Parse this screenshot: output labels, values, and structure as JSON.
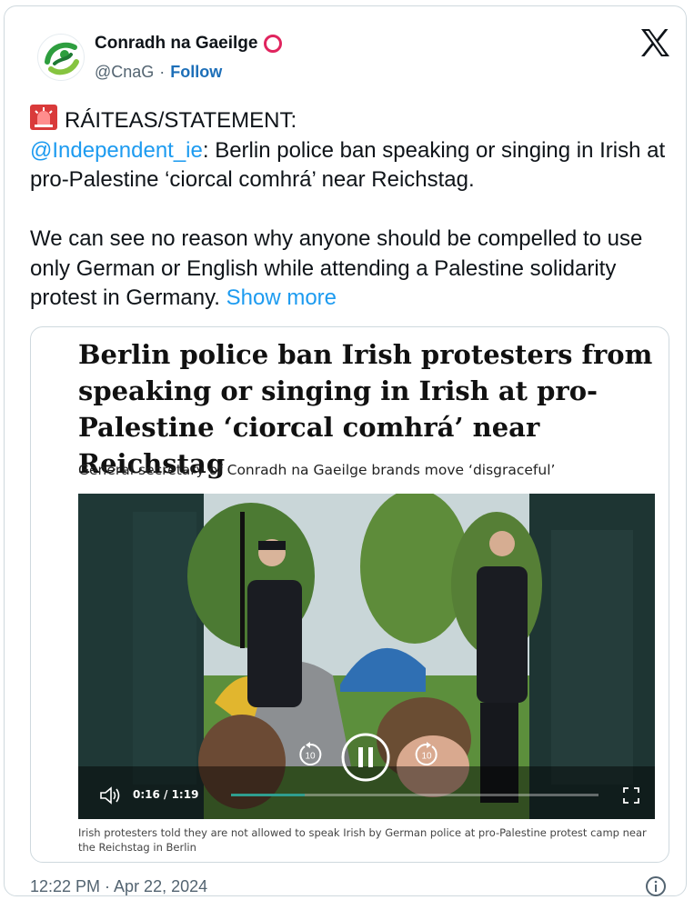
{
  "author": {
    "name": "Conradh na Gaeilge",
    "handle": "@CnaG",
    "separator": "·",
    "follow_label": "Follow",
    "avatar_icon": "conradh-logo-icon",
    "badge_icon": "red-ring-icon"
  },
  "platform_icon": "x-logo-icon",
  "tweet": {
    "emoji_icon": "police-siren-icon",
    "line1": "RÁITEAS/STATEMENT:",
    "mention": "@Independent_ie",
    "mention_rest": ": Berlin police ban speaking or singing in Irish at pro-Palestine ‘ciorcal comhrá’ near Reichstag.",
    "para2": "We can see no reason why anyone should be compelled to use only German or English while attending a Palestine solidarity protest in Germany.",
    "show_more": "Show more"
  },
  "embed": {
    "headline": "Berlin police ban Irish protesters from speaking or singing in Irish at pro-Palestine ‘ciorcal comhrá’ near Reichstag",
    "standfirst": "General secretary of Conradh na Gaeilge brands move ‘disgraceful’",
    "video": {
      "time": "0:16 / 1:19",
      "progress_fraction": 0.2,
      "replay_label": "10",
      "forward_label": "10",
      "icons": [
        "volume-icon",
        "replay-10-icon",
        "pause-icon",
        "forward-10-icon",
        "fullscreen-icon"
      ]
    },
    "caption": "Irish protesters told they are not allowed to speak Irish by German police at pro-Palestine protest camp near the Reichstag in Berlin"
  },
  "footer": {
    "timestamp": "12:22 PM · Apr 22, 2024",
    "info_icon": "info-icon"
  },
  "colors": {
    "link": "#1d9bf0",
    "follow": "#1d6fb8",
    "text": "#0f1419",
    "muted": "#536471",
    "badge": "#e0245e",
    "progress": "#2f9e8f"
  }
}
